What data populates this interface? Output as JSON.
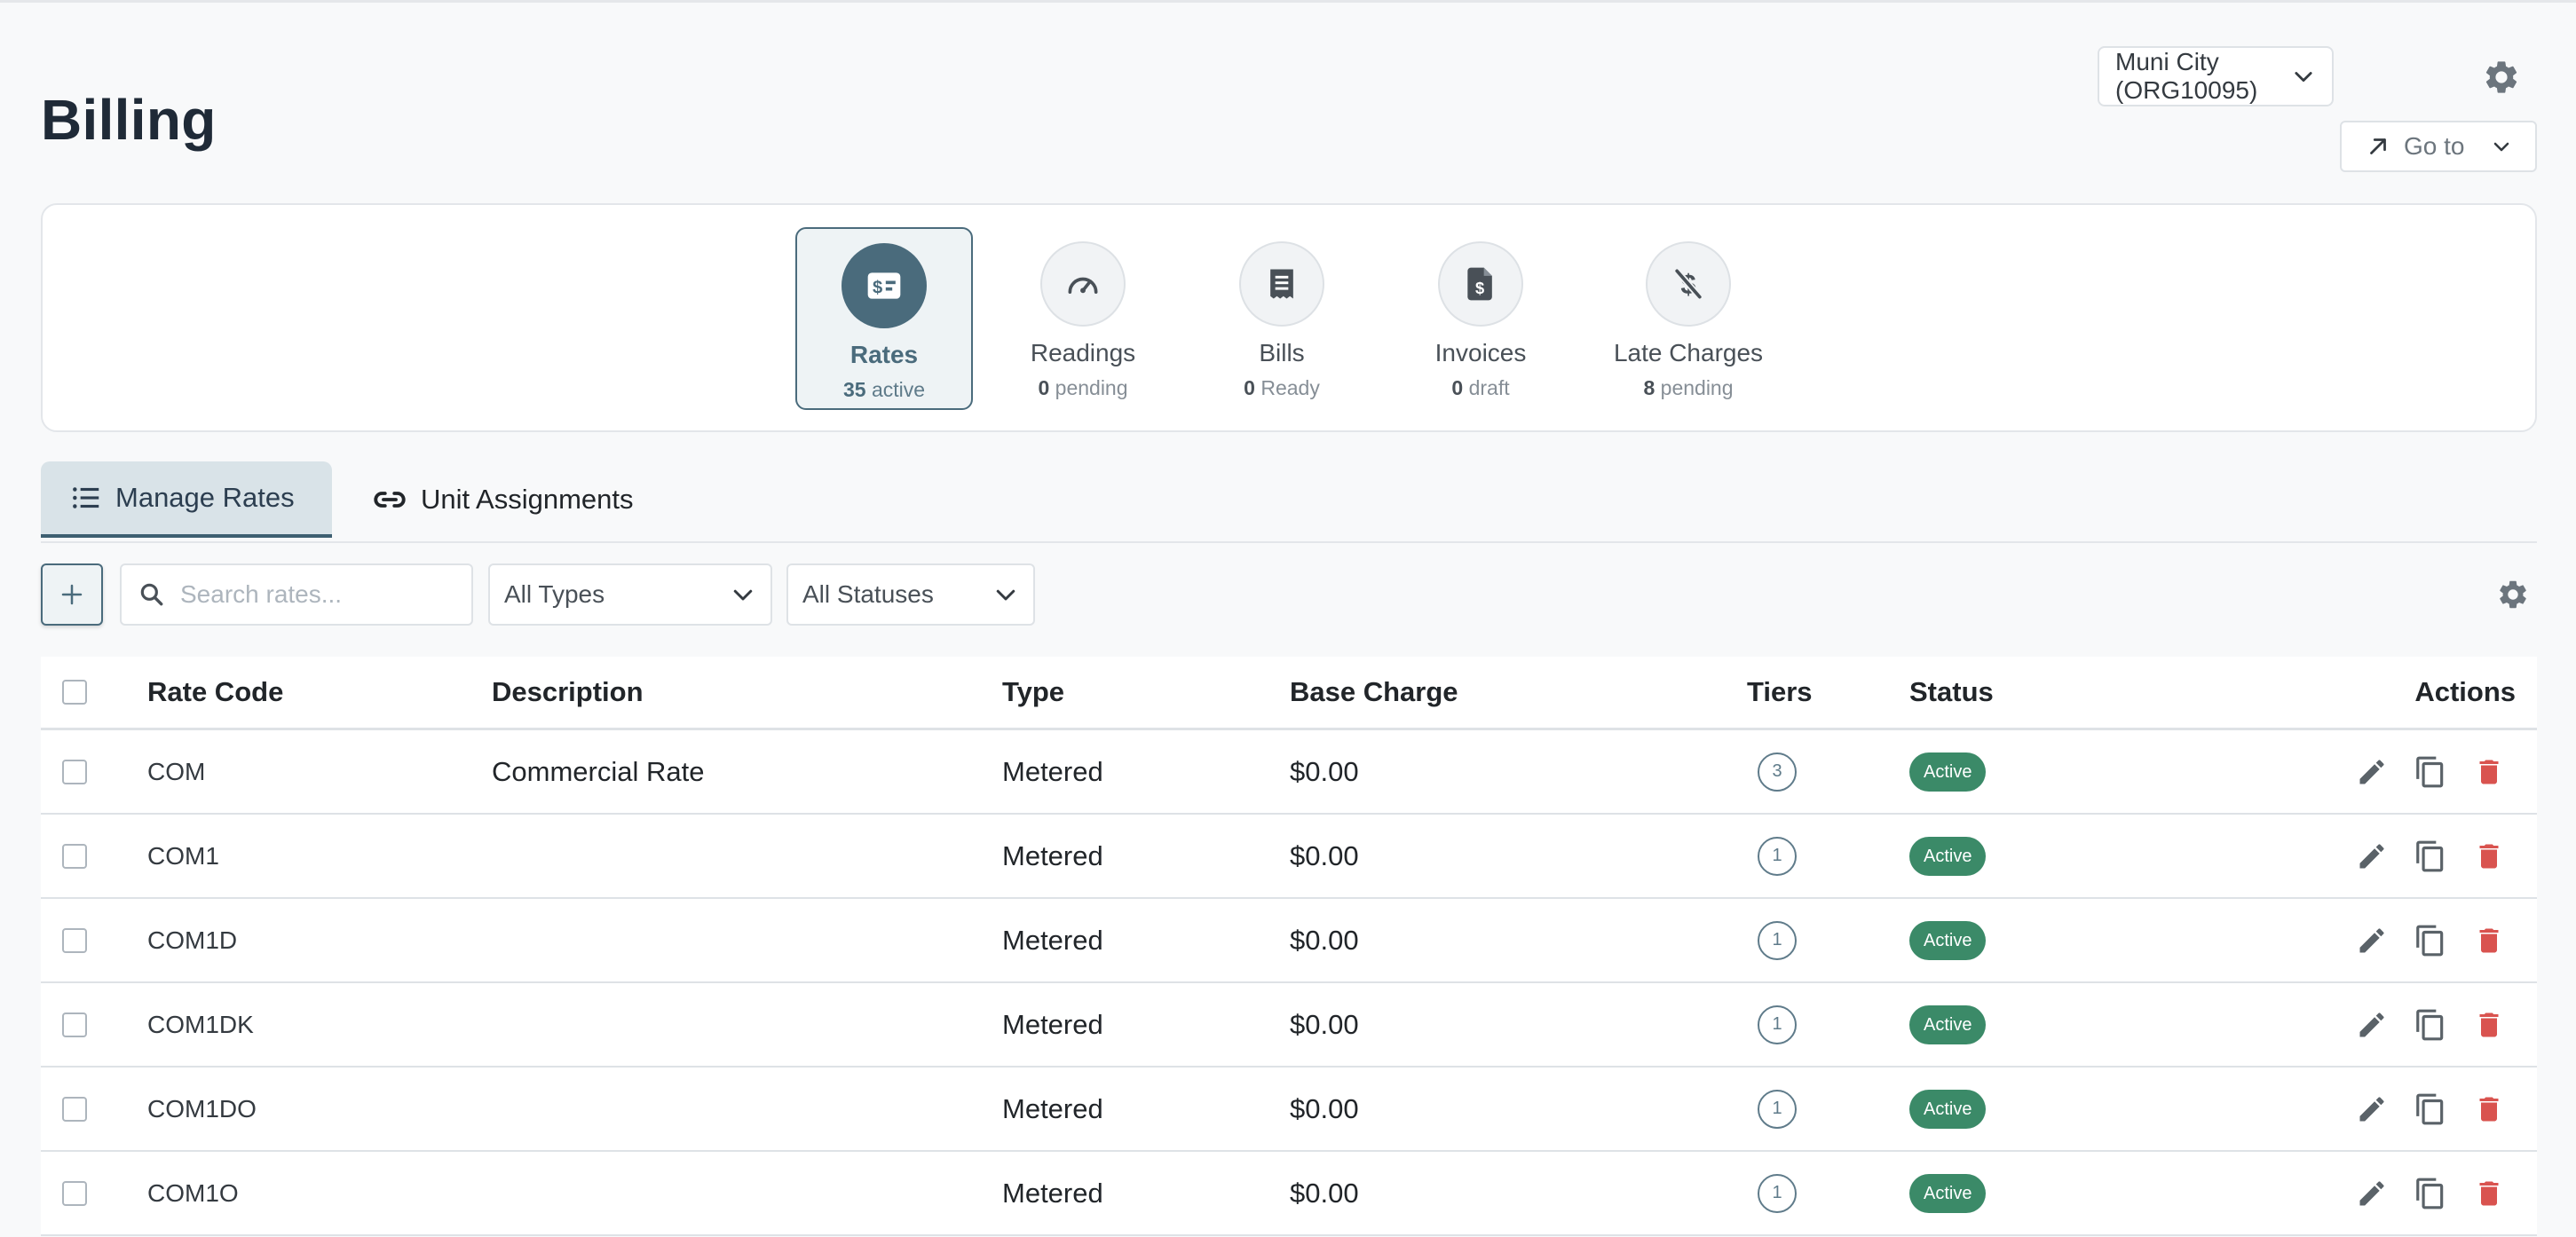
{
  "header": {
    "title": "Billing",
    "org_selector": "Muni City (ORG10095)",
    "goto_label": "Go to"
  },
  "summary": [
    {
      "label": "Rates",
      "count": "35",
      "suffix": "active",
      "icon": "rates-icon",
      "active": true
    },
    {
      "label": "Readings",
      "count": "0",
      "suffix": "pending",
      "icon": "gauge-icon",
      "active": false
    },
    {
      "label": "Bills",
      "count": "0",
      "suffix": "Ready",
      "icon": "receipt-icon",
      "active": false
    },
    {
      "label": "Invoices",
      "count": "0",
      "suffix": "draft",
      "icon": "invoice-icon",
      "active": false
    },
    {
      "label": "Late Charges",
      "count": "8",
      "suffix": "pending",
      "icon": "no-dollar-icon",
      "active": false
    }
  ],
  "tabs": [
    {
      "label": "Manage Rates",
      "icon": "list-icon",
      "active": true
    },
    {
      "label": "Unit Assignments",
      "icon": "link-icon",
      "active": false
    }
  ],
  "toolbar": {
    "search_placeholder": "Search rates...",
    "type_filter": "All Types",
    "status_filter": "All Statuses"
  },
  "table": {
    "columns": [
      "Rate Code",
      "Description",
      "Type",
      "Base Charge",
      "Tiers",
      "Status",
      "Actions"
    ],
    "rows": [
      {
        "code": "COM",
        "description": "Commercial Rate",
        "type": "Metered",
        "base": "$0.00",
        "tiers": "3",
        "status": "Active"
      },
      {
        "code": "COM1",
        "description": "",
        "type": "Metered",
        "base": "$0.00",
        "tiers": "1",
        "status": "Active"
      },
      {
        "code": "COM1D",
        "description": "",
        "type": "Metered",
        "base": "$0.00",
        "tiers": "1",
        "status": "Active"
      },
      {
        "code": "COM1DK",
        "description": "",
        "type": "Metered",
        "base": "$0.00",
        "tiers": "1",
        "status": "Active"
      },
      {
        "code": "COM1DO",
        "description": "",
        "type": "Metered",
        "base": "$0.00",
        "tiers": "1",
        "status": "Active"
      },
      {
        "code": "COM1O",
        "description": "",
        "type": "Metered",
        "base": "$0.00",
        "tiers": "1",
        "status": "Active"
      }
    ]
  },
  "colors": {
    "accent": "#4a6b7c",
    "status_active": "#3b8a68",
    "delete": "#d9534f"
  }
}
